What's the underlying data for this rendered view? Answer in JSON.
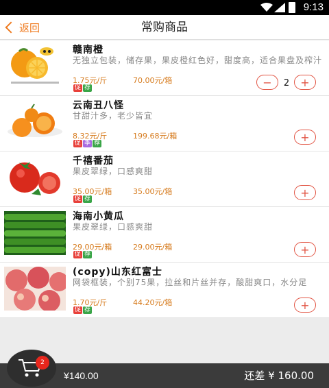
{
  "status": {
    "time": "9:13"
  },
  "header": {
    "back_label": "返回",
    "title": "常购商品"
  },
  "products": [
    {
      "name": "赣南橙",
      "desc": "无独立包装，储存果，果皮橙红色好，甜度高，适合果盘及榨汁",
      "price_unit": "1.75元/斤",
      "price_box": "70.00元/箱",
      "tags": [
        "促",
        "荐"
      ],
      "quantity": "2"
    },
    {
      "name": "云南丑八怪",
      "desc": "甘甜汁多，老少皆宜",
      "price_unit": "8.32元/斤",
      "price_box": "199.68元/箱",
      "tags": [
        "促",
        "季",
        "荐"
      ]
    },
    {
      "name": "千禧番茄",
      "desc": "果皮翠绿，口感爽甜",
      "price_unit": "35.00元/箱",
      "price_box": "35.00元/箱",
      "tags": [
        "促",
        "荐"
      ]
    },
    {
      "name": "海南小黄瓜",
      "desc": "果皮翠绿，口感爽甜",
      "price_unit": "29.00元/箱",
      "price_box": "29.00元/箱",
      "tags": [
        "促",
        "荐"
      ]
    },
    {
      "name": "(copy)山东红富士",
      "desc": "网袋框装，个别75果，拉丝和片丝并存，酸甜爽口，水分足",
      "price_unit": "1.70元/斤",
      "price_box": "44.20元/箱",
      "tags": [
        "促",
        "荐"
      ]
    }
  ],
  "buttons": {
    "minus": "−",
    "plus": "+"
  },
  "footer": {
    "total": "¥140.00",
    "diff": "还差 ¥ 160.00"
  },
  "cart": {
    "count": "2"
  },
  "colors": {
    "accent": "#ef7a1e",
    "price": "#d67a1c",
    "circle": "#e25544",
    "tag_promo": "#e8403a",
    "tag_recommend": "#3aa548",
    "tag_season": "#a86ae0",
    "footer_bg": "#3b3b3b"
  }
}
